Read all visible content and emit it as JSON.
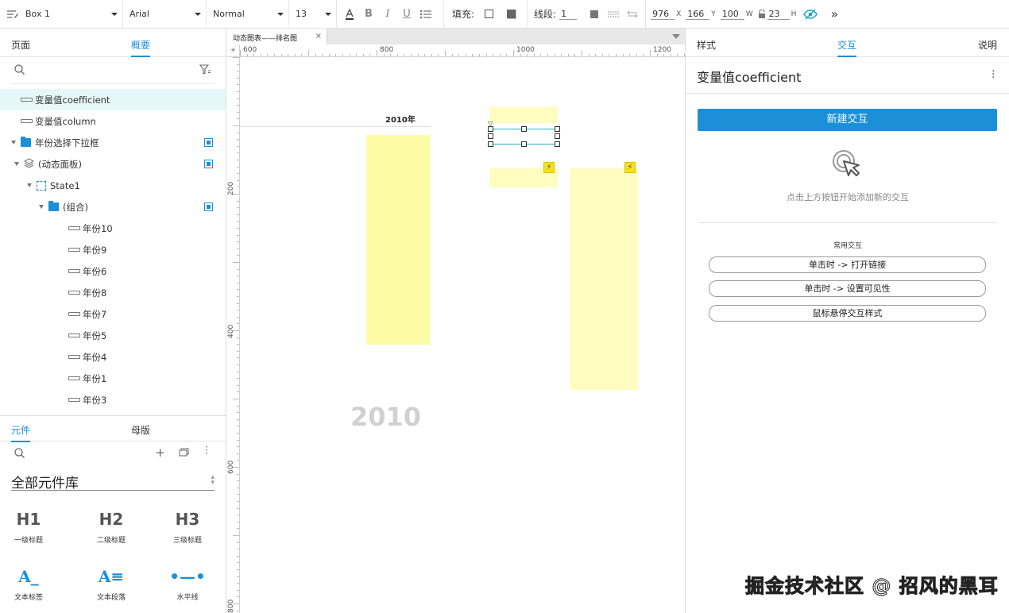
{
  "toolbar": {
    "widget_type": "Box 1",
    "font_family": "Arial",
    "font_style": "Normal",
    "font_size": "13",
    "fill_label": "填充:",
    "stroke_label": "线段:",
    "stroke_width": "1",
    "x": "976",
    "x_unit": "X",
    "y": "166",
    "y_unit": "Y",
    "w": "100",
    "w_unit": "W",
    "h": "23",
    "h_unit": "H"
  },
  "left_panel": {
    "tabs": [
      "页面",
      "概要"
    ],
    "active_tab": "概要",
    "outline": [
      {
        "label": "变量值coefficient",
        "type": "line",
        "indent": 0,
        "selected": true
      },
      {
        "label": "变量值column",
        "type": "line",
        "indent": 0
      },
      {
        "label": "年份选择下拉框",
        "type": "folder",
        "indent": 0,
        "expanded": true,
        "visible_toggle": true
      },
      {
        "label": "(动态面板)",
        "type": "layers",
        "indent": 1,
        "expanded": true,
        "visible_toggle": true
      },
      {
        "label": "State1",
        "type": "state",
        "indent": 2,
        "expanded": true
      },
      {
        "label": "(组合)",
        "type": "folder",
        "indent": 3,
        "expanded": true,
        "visible_toggle": true
      },
      {
        "label": "年份10",
        "type": "line",
        "indent": 4
      },
      {
        "label": "年份9",
        "type": "line",
        "indent": 4
      },
      {
        "label": "年份6",
        "type": "line",
        "indent": 4
      },
      {
        "label": "年份8",
        "type": "line",
        "indent": 4
      },
      {
        "label": "年份7",
        "type": "line",
        "indent": 4
      },
      {
        "label": "年份5",
        "type": "line",
        "indent": 4
      },
      {
        "label": "年份4",
        "type": "line",
        "indent": 4
      },
      {
        "label": "年份1",
        "type": "line",
        "indent": 4
      },
      {
        "label": "年份3",
        "type": "line",
        "indent": 4
      }
    ],
    "library_tabs": [
      "元件",
      "母版"
    ],
    "library_active": "元件",
    "library_title": "全部元件库",
    "widgets": [
      {
        "big": "H1",
        "caption": "一级标题"
      },
      {
        "big": "H2",
        "caption": "二级标题"
      },
      {
        "big": "H3",
        "caption": "三级标题"
      },
      {
        "big": "A_",
        "caption": "文本标签"
      },
      {
        "big": "A≡",
        "caption": "文本段落"
      },
      {
        "big": "•—•",
        "caption": "水平线"
      }
    ]
  },
  "canvas": {
    "tab_title": "动态图表——排名图",
    "ruler_h": [
      "600",
      "800",
      "1000",
      "1200"
    ],
    "ruler_v": [
      "200",
      "400",
      "600",
      "800"
    ],
    "year_header": "2010年",
    "year_big": "2010"
  },
  "right_panel": {
    "tabs": [
      "样式",
      "交互",
      "说明"
    ],
    "active_tab": "交互",
    "widget_name": "变量值coefficient",
    "new_interaction": "新建交互",
    "hint": "点击上方按钮开始添加新的交互",
    "common_title": "常用交互",
    "common": [
      "单击时 -> 打开链接",
      "单击时 -> 设置可见性",
      "鼠标悬停交互样式"
    ]
  },
  "watermark": "掘金技术社区 @ 招风的黑耳",
  "colors": {
    "accent": "#1b8fd8",
    "yellow": "#fefdbf",
    "bolt": "#f3e21a"
  }
}
